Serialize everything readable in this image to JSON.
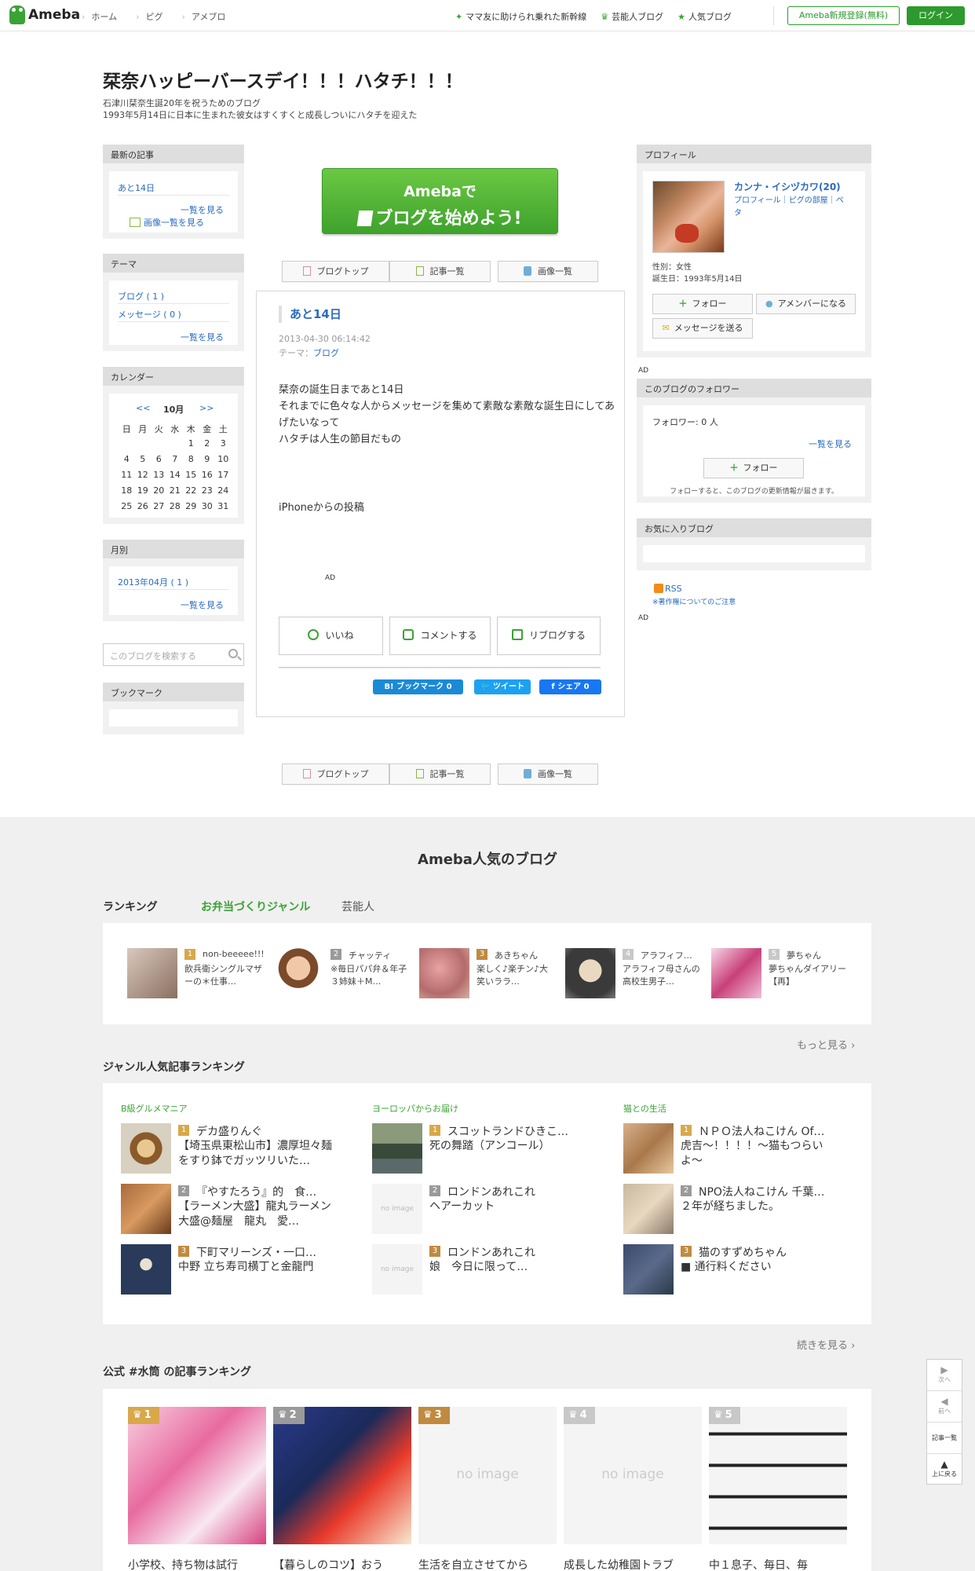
{
  "header": {
    "logo": "Ameba",
    "nav": [
      "ホーム",
      "ピグ",
      "アメブロ"
    ],
    "links": [
      "ママ友に助けられ乗れた新幹線",
      "芸能人ブログ",
      "人気ブログ"
    ],
    "register": "Ameba新規登録(無料)",
    "login": "ログイン"
  },
  "blog": {
    "title": "栞奈ハッピーバースデイ！！！ハタチ！！！",
    "desc1": "石津川栞奈生誕20年を祝うためのブログ",
    "desc2": "1993年5月14日に日本に生まれた彼女はすくすくと成長しついにハタチを迎えた"
  },
  "left": {
    "latest": {
      "title": "最新の記事",
      "item": "あと14日",
      "list": "一覧を見る",
      "imglist": "画像一覧を見る"
    },
    "theme": {
      "title": "テーマ",
      "items": [
        "ブログ ( 1 )",
        "メッセージ ( 0 )"
      ],
      "list": "一覧を見る"
    },
    "calendar": {
      "title": "カレンダー",
      "prev": "<<",
      "month": "10月",
      "next": ">>",
      "weekdays": [
        "日",
        "月",
        "火",
        "水",
        "木",
        "金",
        "土"
      ],
      "rows": [
        [
          "",
          "",
          "",
          "",
          "1",
          "2",
          "3"
        ],
        [
          "4",
          "5",
          "6",
          "7",
          "8",
          "9",
          "10"
        ],
        [
          "11",
          "12",
          "13",
          "14",
          "15",
          "16",
          "17"
        ],
        [
          "18",
          "19",
          "20",
          "21",
          "22",
          "23",
          "24"
        ],
        [
          "25",
          "26",
          "27",
          "28",
          "29",
          "30",
          "31"
        ]
      ]
    },
    "monthly": {
      "title": "月別",
      "item": "2013年04月 ( 1 )",
      "list": "一覧を見る"
    },
    "search_placeholder": "このブログを検索する",
    "bookmark": {
      "title": "ブックマーク"
    }
  },
  "center": {
    "banner_l1": "Amebaで",
    "banner_l2": "ブログを始めよう!",
    "nav": [
      "ブログトップ",
      "記事一覧",
      "画像一覧"
    ],
    "article": {
      "title": "あと14日",
      "date": "2013-04-30 06:14:42",
      "theme_label": "テーマ：",
      "theme": "ブログ",
      "body": "栞奈の誕生日まであと14日\nそれまでに色々な人からメッセージを集めて素敵な素敵な誕生日にしてあげたいなって\nハタチは人生の節目だもの",
      "footer": "iPhoneからの投稿",
      "ad": "AD",
      "actions": [
        "いいね",
        "コメントする",
        "リブログする"
      ],
      "share": {
        "hatena": "B! ブックマーク 0",
        "tweet": "ツイート",
        "fb": "シェア 0"
      }
    }
  },
  "right": {
    "profile": {
      "title": "プロフィール",
      "name": "カンナ・イシヅカワ(20)",
      "links": "プロフィール｜ピグの部屋｜ペタ",
      "gender": "性別：女性",
      "birthday": "誕生日：1993年5月14日",
      "follow": "フォロー",
      "member": "アメンバーになる",
      "message": "メッセージを送る"
    },
    "ad": "AD",
    "followers": {
      "title": "このブログのフォロワー",
      "count": "フォロワー: 0 人",
      "list": "一覧を見る",
      "follow": "フォロー",
      "note": "フォローすると、このブログの更新情報が届きます。"
    },
    "favorites": {
      "title": "お気に入りブログ"
    },
    "rss": "RSS",
    "copyright": "※著作権についてのご注意",
    "ad2": "AD"
  },
  "popular": {
    "title": "Ameba人気のブログ",
    "ranking_label": "ランキング",
    "tabs": [
      "お弁当づくりジャンル",
      "芸能人"
    ],
    "ranks": [
      {
        "num": "1",
        "name": "non-beeeee!!!",
        "desc": "飲兵衛シングルマザーの＊仕事…"
      },
      {
        "num": "2",
        "name": "チャッティ",
        "desc": "※毎日パパ弁＆年子３姉妹＋M…"
      },
      {
        "num": "3",
        "name": "あきちゃん",
        "desc": "楽しく♪楽チン♪大笑いララ…"
      },
      {
        "num": "4",
        "name": "アラフィフ…",
        "desc": "アラフィフ母さんの高校生男子…"
      },
      {
        "num": "5",
        "name": "夢ちゃん",
        "desc": "夢ちゃんダイアリー【再】"
      }
    ],
    "more": "もっと見る",
    "genre_title": "ジャンル人気記事ランキング",
    "genres": [
      {
        "name": "B級グルメマニア",
        "items": [
          {
            "num": "1",
            "l1": "デカ盛りんぐ",
            "l2": "【埼玉県東松山市】濃厚坦々麺をすり鉢でガッツリいた…"
          },
          {
            "num": "2",
            "l1": "『やすたろう』的　食…",
            "l2": "【ラーメン大盛】龍丸ラーメン　大盛@麺屋　龍丸　愛…"
          },
          {
            "num": "3",
            "l1": "下町マリーンズ・一口…",
            "l2": "中野 立ち寿司横丁と金龍門"
          }
        ]
      },
      {
        "name": "ヨーロッパからお届け",
        "items": [
          {
            "num": "1",
            "l1": "スコットランドひきこ…",
            "l2": "死の舞踏（アンコール）"
          },
          {
            "num": "2",
            "l1": "ロンドンあれこれ",
            "l2": "ヘアーカット"
          },
          {
            "num": "3",
            "l1": "ロンドンあれこれ",
            "l2": "娘　今日に限って…"
          }
        ]
      },
      {
        "name": "猫との生活",
        "items": [
          {
            "num": "1",
            "l1": "ＮＰＯ法人ねこけん Of…",
            "l2": "虎吉〜！！！！〜猫もつらいよ〜"
          },
          {
            "num": "2",
            "l1": "NPO法人ねこけん 千葉…",
            "l2": "２年が経ちました。"
          },
          {
            "num": "3",
            "l1": "猫のすずめちゃん",
            "l2": "■ 通行料ください"
          }
        ]
      }
    ],
    "noimage": "no image",
    "more2": "続きを見る",
    "official_title": "公式 #水筒 の記事ランキング",
    "official": [
      {
        "num": "1",
        "cap": "小学校、持ち物は試行"
      },
      {
        "num": "2",
        "cap": "【暮らしのコツ】おう"
      },
      {
        "num": "3",
        "cap": "生活を自立させてから"
      },
      {
        "num": "4",
        "cap": "成長した幼稚園トラブ"
      },
      {
        "num": "5",
        "cap": "中１息子、毎日、毎"
      }
    ],
    "noimage_big": "no image"
  },
  "sidenav": [
    "次へ",
    "前へ",
    "記事一覧",
    "上に戻る"
  ]
}
